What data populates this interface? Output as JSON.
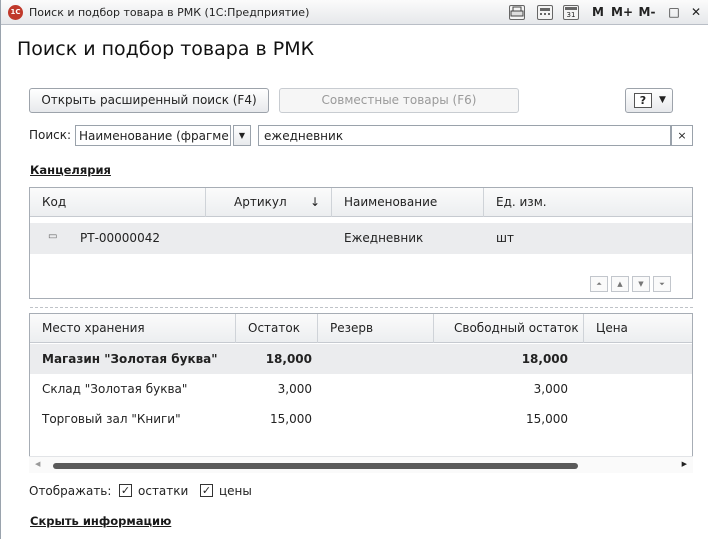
{
  "window": {
    "title": "Поиск и подбор товара в РМК  (1С:Предприятие)",
    "logo": "1С",
    "buttons": {
      "m": "M",
      "m_plus": "M+",
      "m_minus": "M-",
      "restore": "□",
      "close": "✕"
    }
  },
  "page_title": "Поиск и подбор товара в РМК",
  "toolbar": {
    "advanced_search": "Открыть расширенный поиск (F4)",
    "related_goods": "Совместные товары (F6)",
    "help": "?"
  },
  "search": {
    "label": "Поиск:",
    "mode": "Наименование (фрагме",
    "value": "ежедневник",
    "clear": "×"
  },
  "category_link": "Канцелярия",
  "goods_table": {
    "columns": [
      "Код",
      "Артикул",
      "↓",
      "Наименование",
      "Ед. изм."
    ],
    "rows": [
      {
        "code": "РТ-00000042",
        "article": "",
        "name": "Ежедневник",
        "unit": "шт"
      }
    ]
  },
  "stock_table": {
    "columns": [
      "Место хранения",
      "Остаток",
      "Резерв",
      "Свободный остаток",
      "Цена"
    ],
    "rows": [
      {
        "place": "Магазин \"Золотая буква\"",
        "rest": "18,000",
        "reserve": "",
        "free": "18,000",
        "price": ""
      },
      {
        "place": "Склад \"Золотая буква\"",
        "rest": "3,000",
        "reserve": "",
        "free": "3,000",
        "price": ""
      },
      {
        "place": "Торговый зал \"Книги\"",
        "rest": "15,000",
        "reserve": "",
        "free": "15,000",
        "price": ""
      }
    ]
  },
  "display": {
    "label": "Отображать:",
    "show_rests": "остатки",
    "show_prices": "цены",
    "rests_checked": true,
    "prices_checked": true
  },
  "hide_info_link": "Скрыть информацию",
  "colors": {
    "selected_row": "#ebecee",
    "border": "#a7adb5"
  }
}
